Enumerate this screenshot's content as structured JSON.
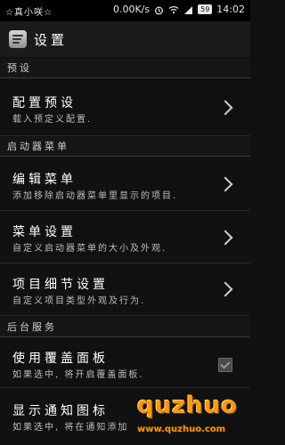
{
  "status_bar": {
    "carrier": "☆真小咲☆",
    "speed": "0.00K/s",
    "battery": "59",
    "time": "14:02"
  },
  "action_bar": {
    "title": "设置"
  },
  "sections": {
    "presets": {
      "header": "预设",
      "items": [
        {
          "title": "配置预设",
          "summary": "载入预定义配置."
        }
      ]
    },
    "launcher_menu": {
      "header": "启动器菜单",
      "items": [
        {
          "title": "编辑菜单",
          "summary": "添加移除启动器菜单里显示的项目."
        },
        {
          "title": "菜单设置",
          "summary": "自定义启动器菜单的大小及外观."
        },
        {
          "title": "项目细节设置",
          "summary": "自定义项目类型外观及行为."
        }
      ]
    },
    "background_service": {
      "header": "后台服务",
      "items": [
        {
          "title": "使用覆盖面板",
          "summary": "如果选中, 将开启覆盖面板.",
          "checked": true
        },
        {
          "title": "显示通知图标",
          "summary": "如果选中, 将在通知添加"
        }
      ]
    }
  },
  "watermark": {
    "brand": "quzhuo",
    "url": "www.quzhuo.com"
  }
}
